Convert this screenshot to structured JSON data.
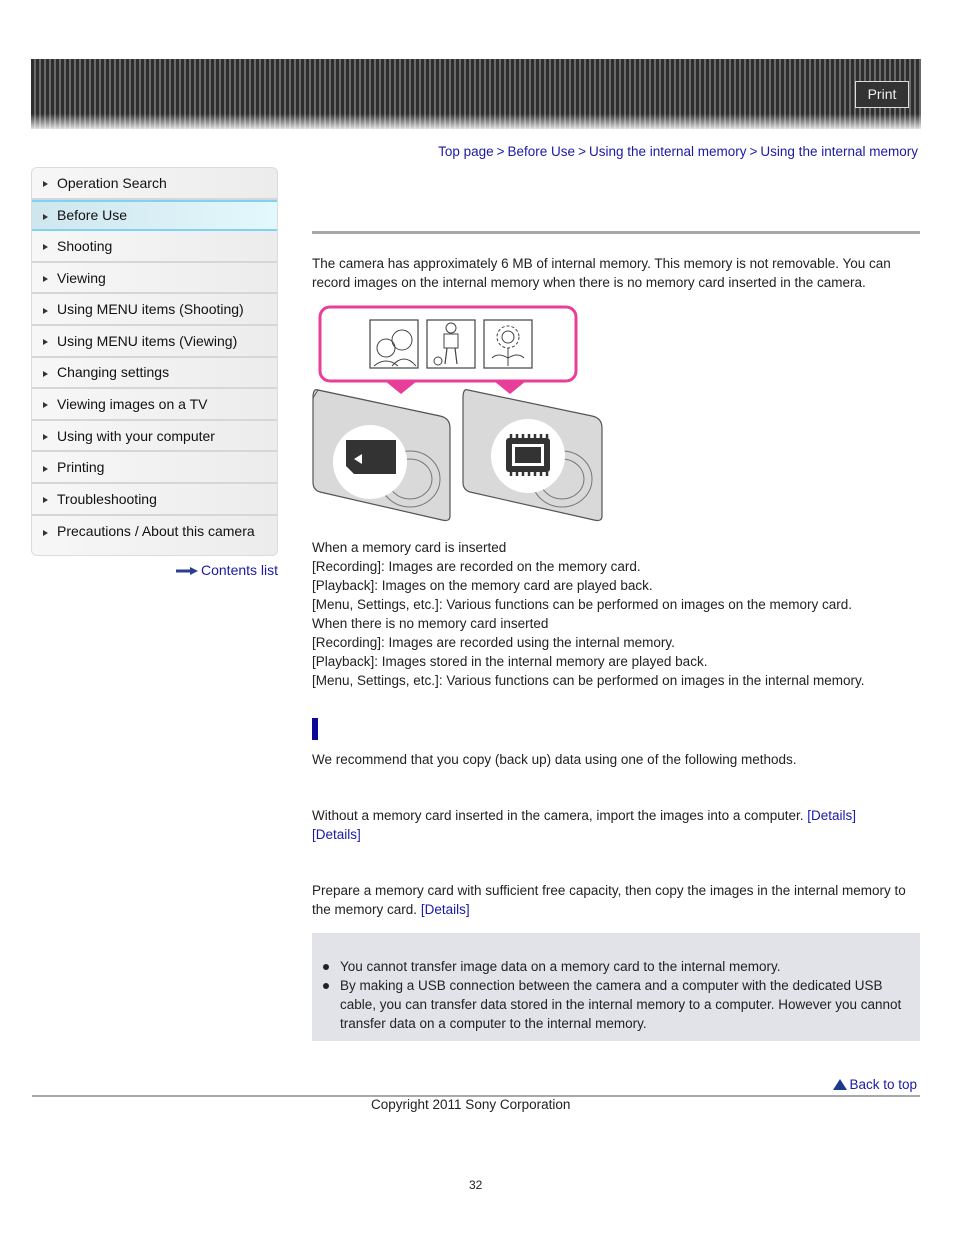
{
  "header": {
    "print_label": "Print"
  },
  "breadcrumb": {
    "items": [
      "Top page",
      "Before Use",
      "Using the internal memory",
      "Using the internal memory"
    ],
    "separator": ">"
  },
  "sidebar": {
    "items": [
      {
        "label": "Operation Search",
        "active": false
      },
      {
        "label": "Before Use",
        "active": true
      },
      {
        "label": "Shooting",
        "active": false
      },
      {
        "label": "Viewing",
        "active": false
      },
      {
        "label": "Using MENU items (Shooting)",
        "active": false
      },
      {
        "label": "Using MENU items (Viewing)",
        "active": false
      },
      {
        "label": "Changing settings",
        "active": false
      },
      {
        "label": "Viewing images on a TV",
        "active": false
      },
      {
        "label": "Using with your computer",
        "active": false
      },
      {
        "label": "Printing",
        "active": false
      },
      {
        "label": "Troubleshooting",
        "active": false
      },
      {
        "label": "Precautions / About this camera",
        "active": false
      }
    ],
    "contents_list_label": "Contents list"
  },
  "main": {
    "intro": "The camera has approximately 6 MB of internal memory. This memory is not removable. You can record images on the internal memory when there is no memory card inserted in the camera.",
    "illustration": {
      "left_camera_icon": "memory-card-icon",
      "right_camera_icon": "internal-memory-chip-icon",
      "accent_color": "#e83e9a"
    },
    "modes": [
      "When a memory card is inserted",
      "[Recording]: Images are recorded on the memory card.",
      "[Playback]: Images on the memory card are played back.",
      "[Menu, Settings, etc.]: Various functions can be performed on images on the memory card.",
      "When there is no memory card inserted",
      "[Recording]: Images are recorded using the internal memory.",
      "[Playback]: Images stored in the internal memory are played back.",
      "[Menu, Settings, etc.]: Various functions can be performed on images in the internal memory."
    ],
    "backup_intro": "We recommend that you copy (back up) data using one of the following methods.",
    "method1_text": "Without a memory card inserted in the camera, import the images into a computer.",
    "method1_link1": "[Details]",
    "method1_link2": "[Details]",
    "method2_text": "Prepare a memory card with sufficient free capacity, then copy the images in the internal memory to the memory card.",
    "method2_link": "[Details]",
    "notes": [
      "You cannot transfer image data on a memory card to the internal memory.",
      "By making a USB connection between the camera and a computer with the dedicated USB cable, you can transfer data stored in the internal memory to a computer. However you cannot transfer data on a computer to the internal memory."
    ]
  },
  "footer": {
    "back_to_top": "Back to top",
    "copyright": "Copyright 2011 Sony Corporation",
    "page_number": "32"
  },
  "colors": {
    "link": "#1a1aa6",
    "section_marker": "#0a0a96",
    "active_nav_border": "#7fd3f2",
    "note_background": "#e1e3e8"
  }
}
